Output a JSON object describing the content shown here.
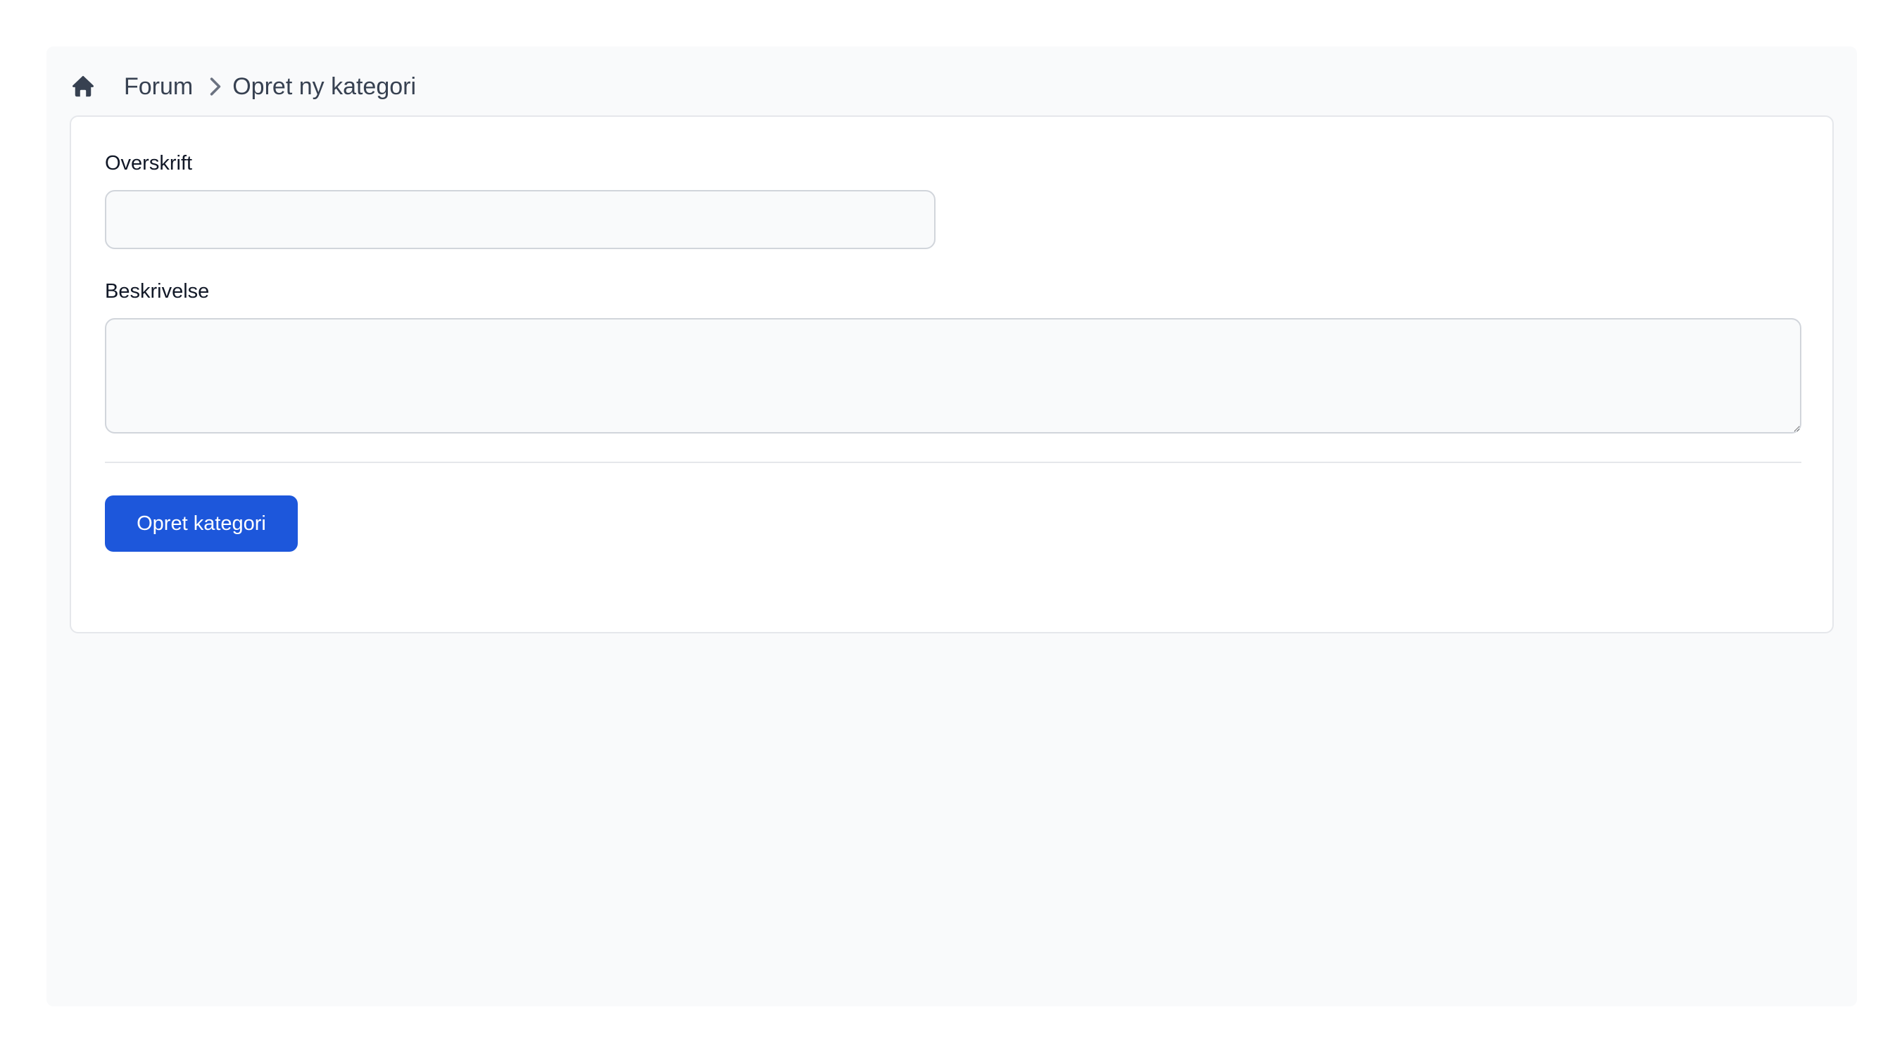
{
  "breadcrumb": {
    "home_icon": "home-icon",
    "separator_icon": "chevron-right-icon",
    "forum_label": "Forum",
    "current_label": "Opret ny kategori"
  },
  "form": {
    "title_label": "Overskrift",
    "title_value": "",
    "title_placeholder": "",
    "description_label": "Beskrivelse",
    "description_value": "",
    "description_placeholder": "",
    "submit_label": "Opret kategori"
  },
  "colors": {
    "accent": "#1d57db",
    "page_background": "#f9fafb",
    "card_background": "#ffffff",
    "text": "#111827",
    "breadcrumb_text": "#374151"
  }
}
